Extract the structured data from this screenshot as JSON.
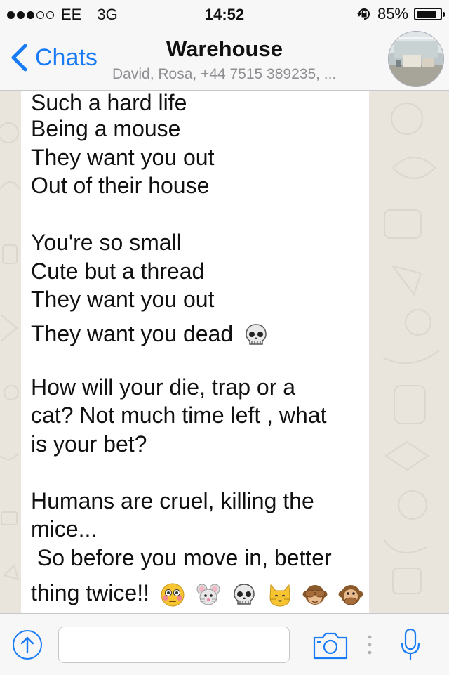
{
  "status_bar": {
    "carrier": "EE",
    "network": "3G",
    "time": "14:52",
    "battery_text": "85%",
    "battery_level": 0.85,
    "signal_bars_filled": 3,
    "signal_bars_total": 5
  },
  "nav": {
    "back_label": "Chats",
    "title": "Warehouse",
    "subtitle": "David, Rosa, +44 7515 389235, ..."
  },
  "message": {
    "stanza1": [
      "Such a hard life",
      "Being a mouse",
      "They want you out",
      "Out of their house"
    ],
    "stanza2": [
      "You're so small",
      "Cute but a thread",
      "They want you out",
      "They want you dead"
    ],
    "stanza3": [
      "How will your die, trap or a",
      "cat? Not much time left , what",
      "is your bet?"
    ],
    "stanza4": [
      "Humans are cruel, killing the",
      "mice...",
      " So before you move in, better",
      "thing twice!!"
    ]
  },
  "input": {
    "value": "",
    "placeholder": ""
  },
  "colors": {
    "accent": "#1a7cf5",
    "bubble": "#ffffff",
    "wallpaper": "#e9e4dc"
  },
  "icons": {
    "back": "chevron-left-icon",
    "attach": "share-up-icon",
    "camera": "camera-icon",
    "more": "more-vertical-icon",
    "mic": "microphone-icon"
  }
}
